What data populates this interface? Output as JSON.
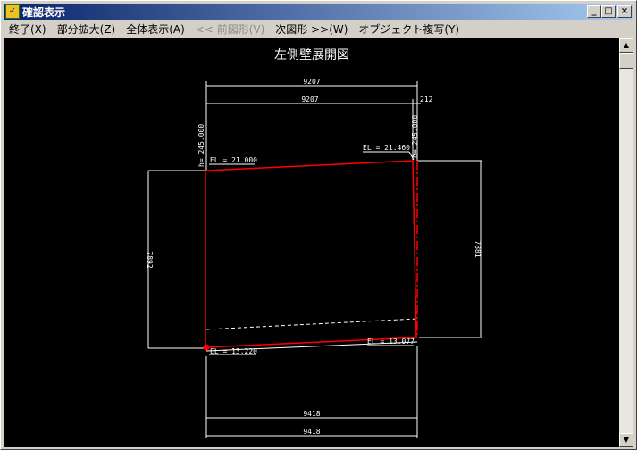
{
  "window": {
    "title": "確認表示",
    "icon": "app-icon",
    "controls": [
      "minimize",
      "maximize",
      "close"
    ]
  },
  "menu": [
    {
      "label": "終了(X)",
      "enabled": true
    },
    {
      "label": "部分拡大(Z)",
      "enabled": true
    },
    {
      "label": "全体表示(A)",
      "enabled": true
    },
    {
      "label": "<< 前図形(V)",
      "enabled": false
    },
    {
      "label": "次図形 >>(W)",
      "enabled": true
    },
    {
      "label": "オブジェクト複写(Y)",
      "enabled": true
    }
  ],
  "drawing": {
    "title": "左側壁展開図",
    "dim_top_outer": "9207",
    "dim_top_inner": "9207",
    "dim_top_offset": "212",
    "h_left": "h= 245.000",
    "h_right": "h= 245.000",
    "el_top_left": "EL = 21.000",
    "el_top_right": "EL = 21.460",
    "el_bottom_left": "EL = 13.220",
    "el_bottom_right": "EL = 13.077",
    "dim_left": "7892",
    "dim_right": "7881",
    "dim_bottom_inner": "9418",
    "dim_bottom_outer": "9418",
    "colors": {
      "background": "#000000",
      "line": "#ffffff",
      "highlight": "#ff0000"
    }
  }
}
